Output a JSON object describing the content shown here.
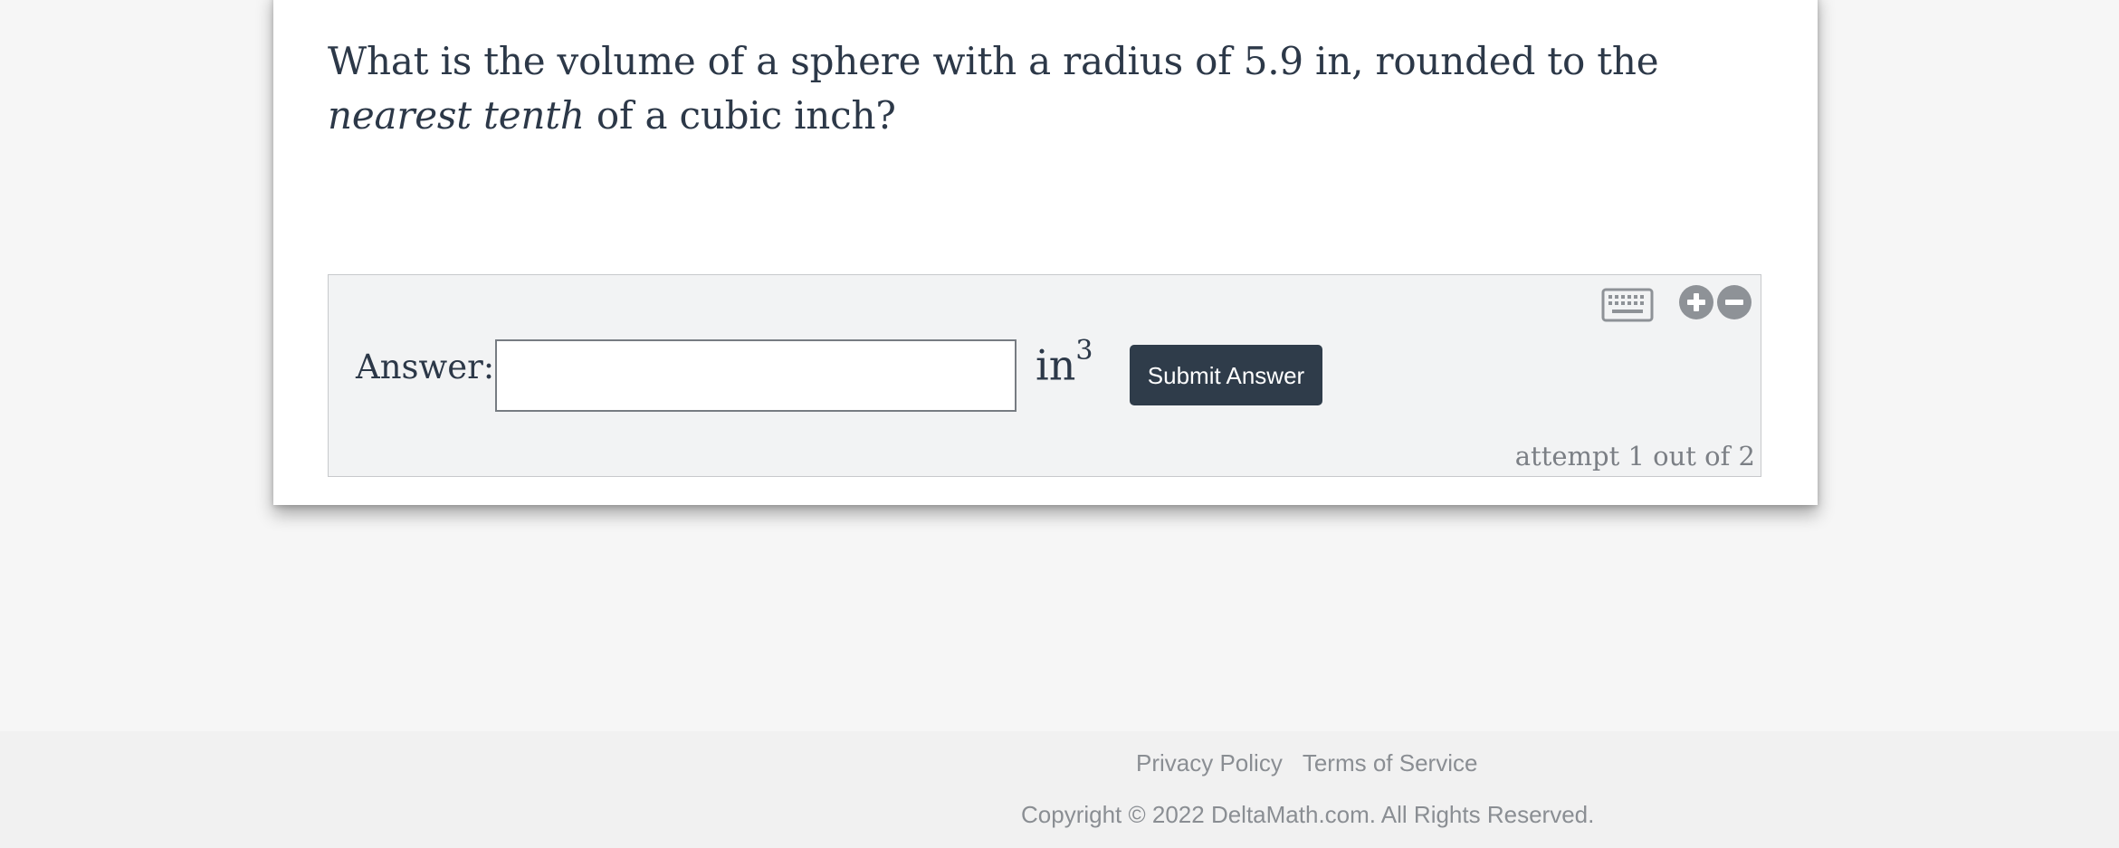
{
  "question": {
    "text_before": "What is the volume of a sphere with a radius of 5.9 in, rounded to the ",
    "emphasis": "nearest tenth",
    "text_after": " of a cubic inch?"
  },
  "answer": {
    "label": "Answer:",
    "input_value": "",
    "unit_base": "in",
    "unit_exponent": "3",
    "submit_label": "Submit Answer",
    "attempt_text": "attempt 1 out of 2"
  },
  "icons": {
    "keyboard": "keyboard-icon",
    "zoom_in": "plus-circle-icon",
    "zoom_out": "minus-circle-icon"
  },
  "footer": {
    "privacy": "Privacy Policy",
    "terms": "Terms of Service",
    "copyright": "Copyright © 2022 DeltaMath.com. All Rights Reserved."
  },
  "colors": {
    "text": "#2c3848",
    "button": "#2f3c4a",
    "panel": "#f2f3f4",
    "icon": "#8e9297"
  }
}
